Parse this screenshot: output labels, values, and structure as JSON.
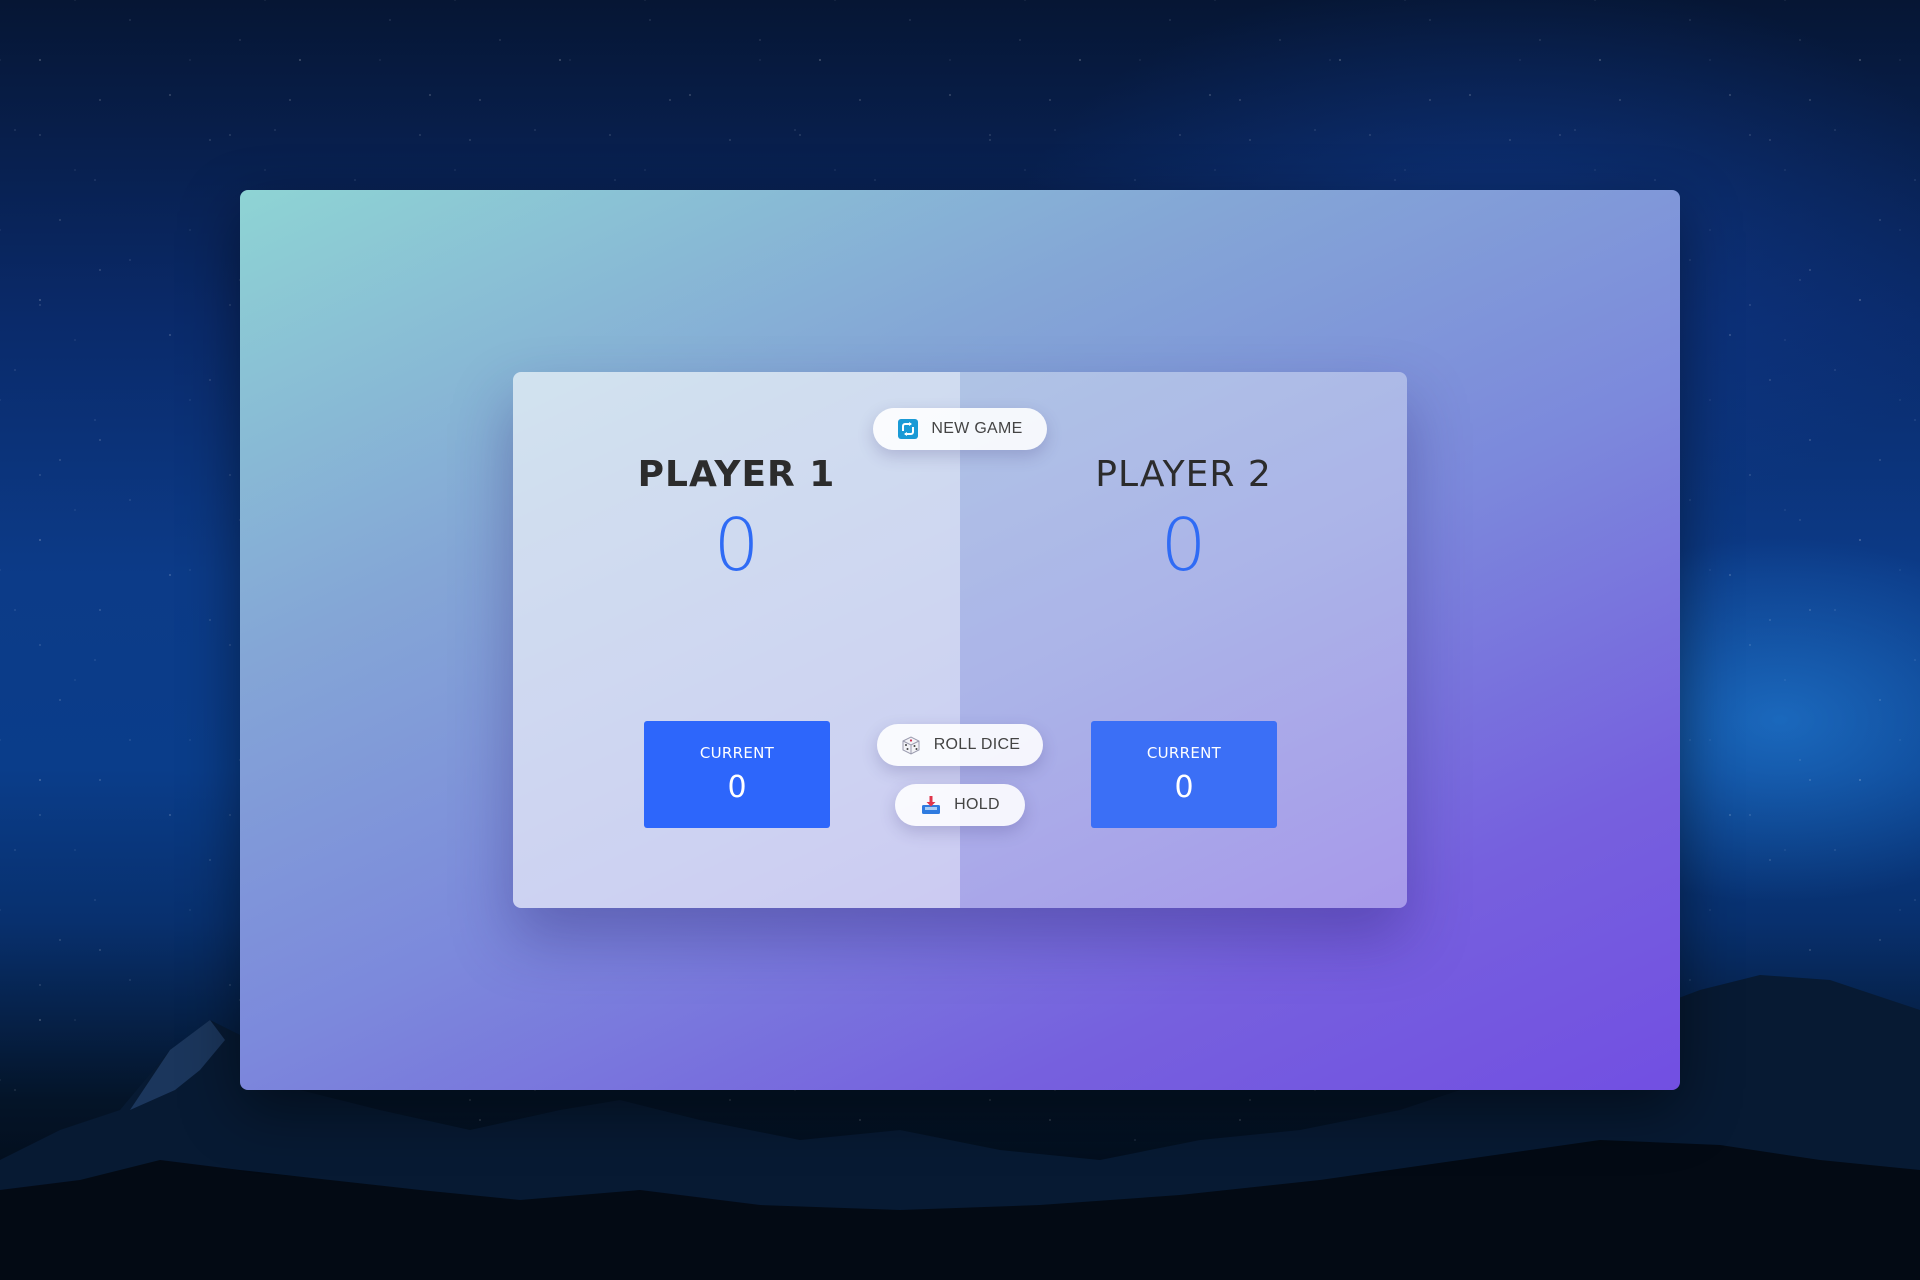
{
  "game": {
    "new_game_label": "NEW GAME",
    "roll_dice_label": "ROLL DICE",
    "hold_label": "HOLD"
  },
  "players": [
    {
      "name": "PLAYER 1",
      "score": "0",
      "current_label": "CURRENT",
      "current_score": "0",
      "active": true
    },
    {
      "name": "PLAYER 2",
      "score": "0",
      "current_label": "CURRENT",
      "current_score": "0",
      "active": false
    }
  ],
  "icons": {
    "new_game": "refresh-icon",
    "roll_dice": "dice-icon",
    "hold": "inbox-download-icon"
  },
  "colors": {
    "accent": "#2f6bf5",
    "current_box": "#2d66fb",
    "window_gradient_start": "#8ed4d4",
    "window_gradient_end": "#724fe2"
  }
}
